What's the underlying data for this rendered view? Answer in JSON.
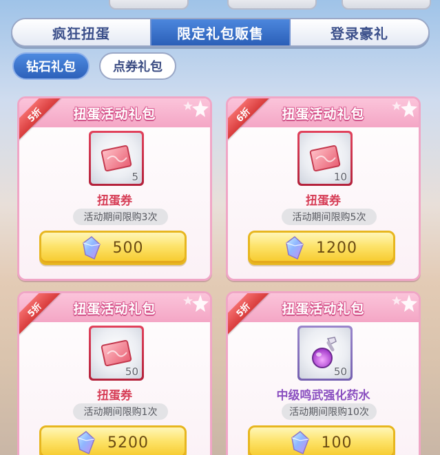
{
  "main_tabs": [
    {
      "label": "疯狂扭蛋",
      "active": false
    },
    {
      "label": "限定礼包贩售",
      "active": true
    },
    {
      "label": "登录豪礼",
      "active": false
    }
  ],
  "sub_tabs": [
    {
      "label": "钻石礼包",
      "active": true
    },
    {
      "label": "点券礼包",
      "active": false
    }
  ],
  "packs": [
    {
      "title": "扭蛋活动礼包",
      "discount": "5折",
      "item_name": "扭蛋券",
      "item_icon": "gacha-ticket-icon",
      "quantity": "5",
      "limit": "活动期间限购3次",
      "price_icon": "diamond-icon",
      "price": "500"
    },
    {
      "title": "扭蛋活动礼包",
      "discount": "6折",
      "item_name": "扭蛋券",
      "item_icon": "gacha-ticket-icon",
      "quantity": "10",
      "limit": "活动期间限购5次",
      "price_icon": "diamond-icon",
      "price": "1200"
    },
    {
      "title": "扭蛋活动礼包",
      "discount": "5折",
      "item_name": "扭蛋券",
      "item_icon": "gacha-ticket-icon",
      "quantity": "50",
      "limit": "活动期间限购1次",
      "price_icon": "diamond-icon",
      "price": "5200"
    },
    {
      "title": "扭蛋活动礼包",
      "discount": "5折",
      "item_name": "中级鸣武强化药水",
      "item_icon": "potion-icon",
      "quantity": "50",
      "limit": "活动期间限购10次",
      "price_icon": "diamond-icon",
      "price": "100"
    }
  ],
  "colors": {
    "accent_blue": "#2b5fb8",
    "card_pink": "#f4a6c5",
    "ribbon_red": "#d83b3b",
    "item_name_red": "#d63c55",
    "item_name_purple": "#8a4fc0",
    "button_gold": "#f6c92a"
  }
}
